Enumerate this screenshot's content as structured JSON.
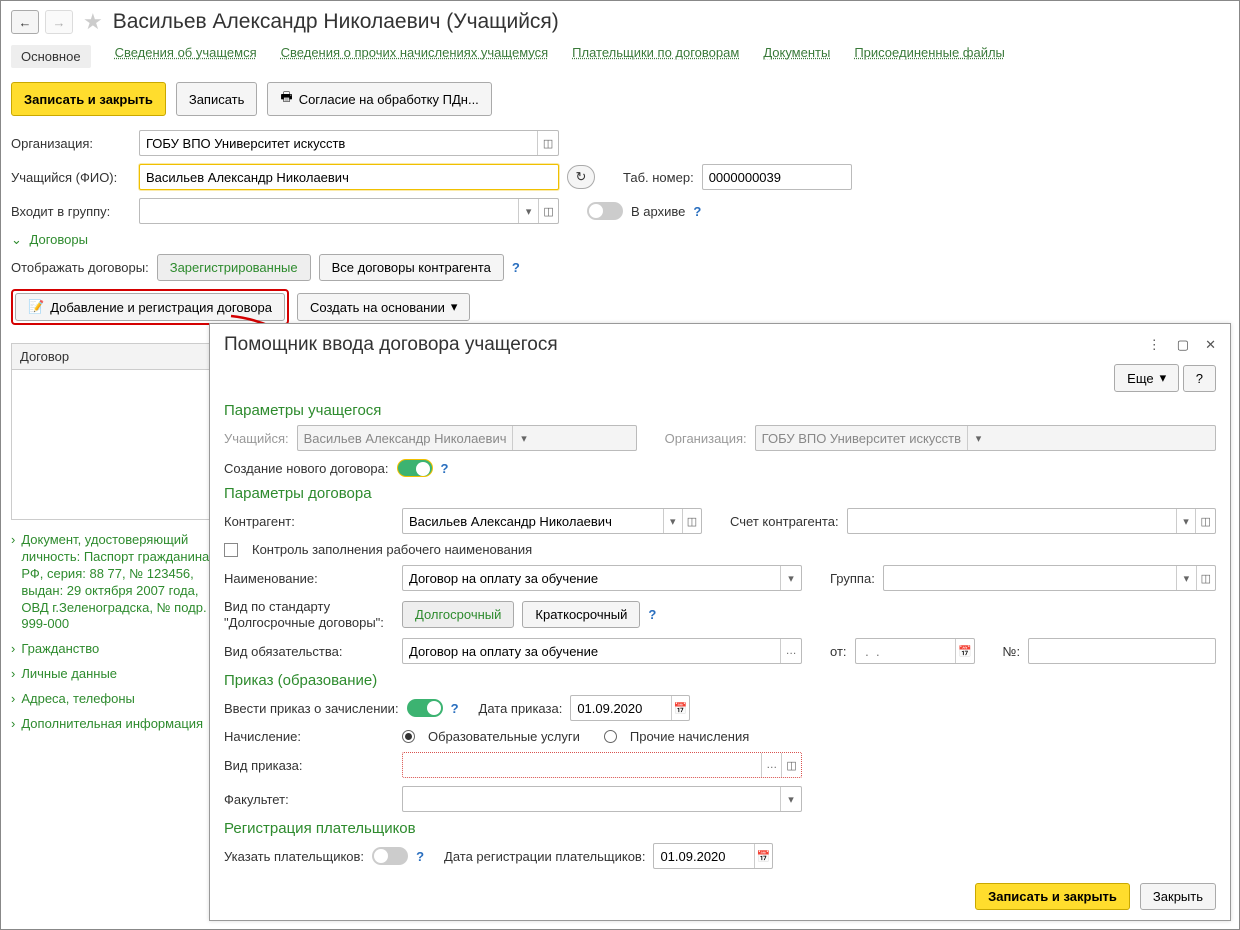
{
  "header": {
    "title": "Васильев Александр Николаевич (Учащийся)"
  },
  "tabs": {
    "main": "Основное",
    "student_info": "Сведения об учащемся",
    "other_charges": "Сведения о прочих начислениях учащемуся",
    "payers": "Плательщики по договорам",
    "documents": "Документы",
    "files": "Присоединенные файлы"
  },
  "toolbar": {
    "save_close": "Записать и закрыть",
    "save": "Записать",
    "consent": "Согласие на обработку ПДн..."
  },
  "form": {
    "org_label": "Организация:",
    "org_value": "ГОБУ ВПО Университет искусств",
    "student_label": "Учащийся (ФИО):",
    "student_value": "Васильев Александр Николаевич",
    "tab_num_label": "Таб. номер:",
    "tab_num_value": "0000000039",
    "group_label": "Входит в группу:",
    "group_value": "",
    "archive_label": "В архиве"
  },
  "contracts": {
    "header": "Договоры",
    "display_label": "Отображать договоры:",
    "registered": "Зарегистрированные",
    "all": "Все договоры контрагента",
    "add_reg": "Добавление и регистрация договора",
    "create_based": "Создать на основании",
    "table_col": "Договор"
  },
  "side": {
    "doc_identity": "Документ, удостоверяющий личность: Паспорт гражданина РФ, серия: 88 77, № 123456, выдан: 29 октября 2007 года, ОВД г.Зеленоградска, № подр. 999-000",
    "citizenship": "Гражданство",
    "personal": "Личные данные",
    "addresses": "Адреса, телефоны",
    "additional": "Дополнительная информация"
  },
  "wizard": {
    "title": "Помощник ввода договора учащегося",
    "more": "Еще",
    "sec_student": "Параметры учащегося",
    "student_label": "Учащийся:",
    "student_value": "Васильев Александр Николаевич",
    "org_label": "Организация:",
    "org_value": "ГОБУ ВПО Университет искусств",
    "new_contract_label": "Создание нового договора:",
    "sec_contract": "Параметры договора",
    "counterparty_label": "Контрагент:",
    "counterparty_value": "Васильев Александр Николаевич",
    "account_label": "Счет контрагента:",
    "control_label": "Контроль заполнения рабочего наименования",
    "name_label": "Наименование:",
    "name_value": "Договор на оплату за обучение",
    "group_label": "Группа:",
    "std_label": "Вид по стандарту \"Долгосрочные договоры\":",
    "long": "Долгосрочный",
    "short": "Краткосрочный",
    "obligation_label": "Вид обязательства:",
    "obligation_value": "Договор на оплату за обучение",
    "from_label": "от:",
    "date_placeholder": " .  .",
    "num_label": "№:",
    "sec_order": "Приказ (образование)",
    "enroll_label": "Ввести приказ о зачислении:",
    "order_date_label": "Дата приказа:",
    "order_date_value": "01.09.2020",
    "charge_label": "Начисление:",
    "radio_edu": "Образовательные услуги",
    "radio_other": "Прочие начисления",
    "order_type_label": "Вид приказа:",
    "faculty_label": "Факультет:",
    "sec_payers": "Регистрация плательщиков",
    "specify_label": "Указать плательщиков:",
    "reg_date_label": "Дата регистрации плательщиков:",
    "reg_date_value": "01.09.2020",
    "save_close": "Записать и закрыть",
    "close": "Закрыть",
    "help": "?"
  }
}
